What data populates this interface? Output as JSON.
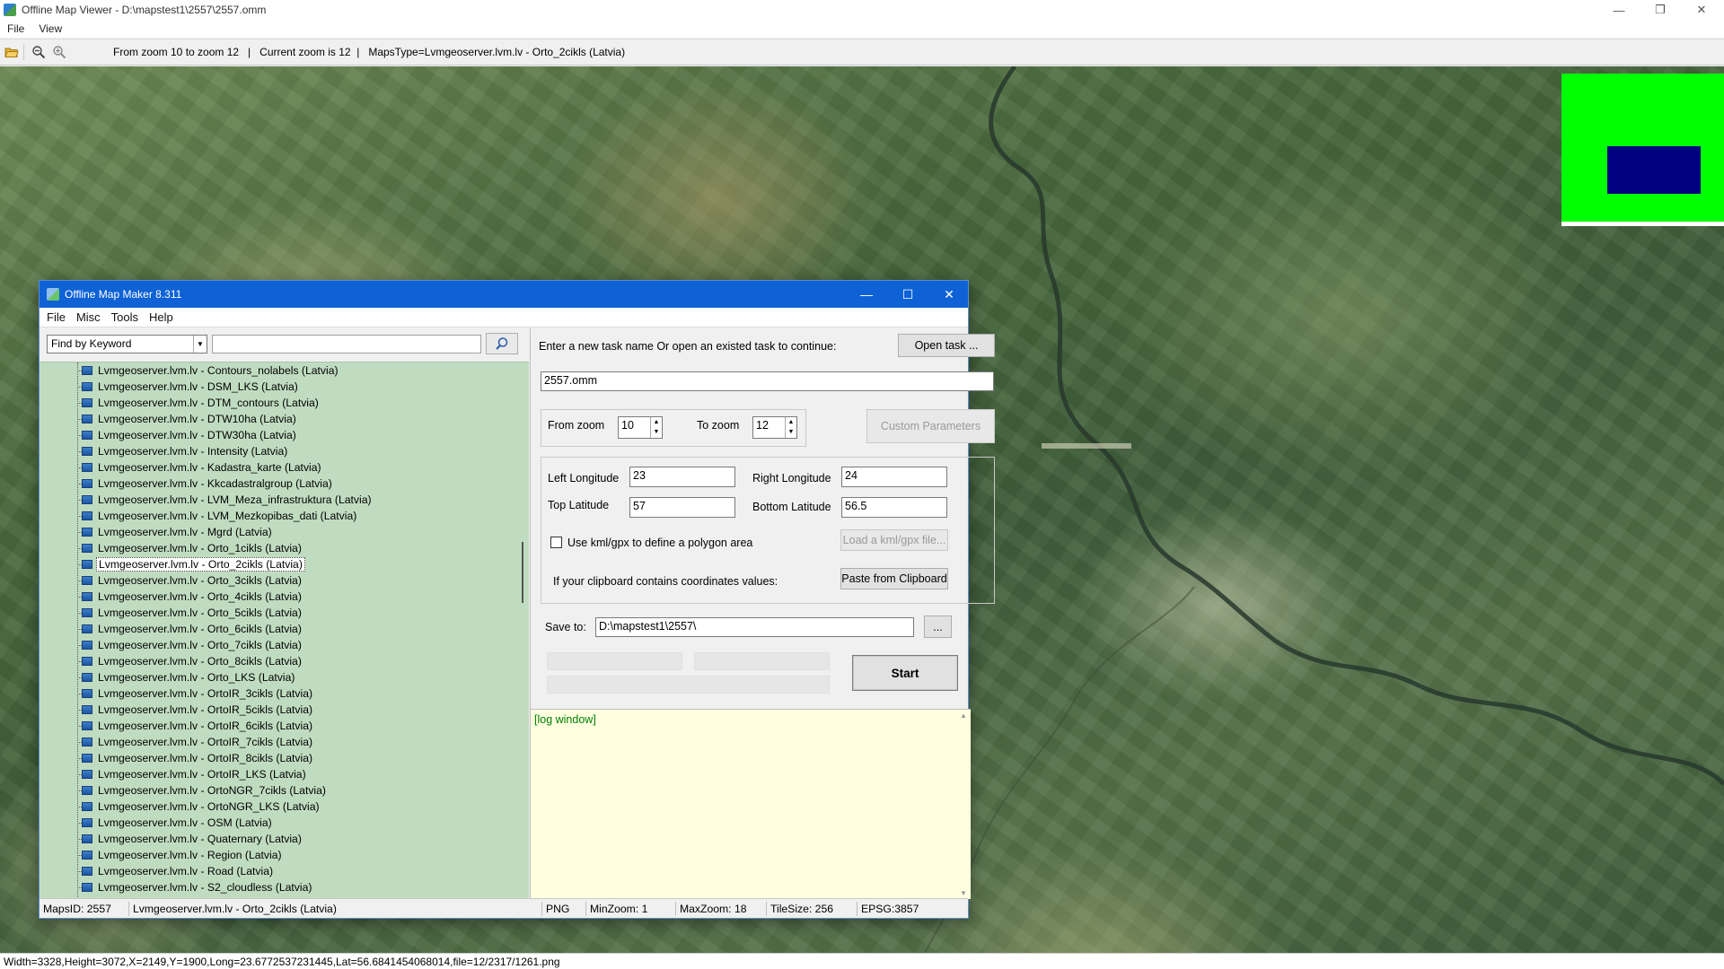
{
  "viewer": {
    "title": "Offline Map Viewer - D:\\mapstest1\\2557\\2557.omm",
    "window_controls": {
      "minimize": "—",
      "maximize": "❐",
      "close": "✕"
    },
    "menu": [
      "File",
      "View"
    ],
    "toolbar_info": "From zoom 10 to zoom 12   |   Current zoom is 12  |   MapsType=Lvmgeoserver.lvm.lv - Orto_2cikls (Latvia)",
    "status": "Width=3328,Height=3072,X=2149,Y=1900,Long=23.6772537231445,Lat=56.6841454068014,file=12/2317/1261.png",
    "minimap_colors": {
      "background": "#00ff00",
      "viewport": "#000080"
    }
  },
  "dialog": {
    "title": "Offline Map Maker 8.311",
    "window_controls": {
      "minimize": "—",
      "maximize": "☐",
      "close": "✕"
    },
    "menu": [
      "File",
      "Misc",
      "Tools",
      "Help"
    ],
    "search": {
      "mode": "Find by Keyword",
      "value": ""
    },
    "tree_items": [
      "Lvmgeoserver.lvm.lv - Contours_nolabels (Latvia)",
      "Lvmgeoserver.lvm.lv - DSM_LKS (Latvia)",
      "Lvmgeoserver.lvm.lv - DTM_contours (Latvia)",
      "Lvmgeoserver.lvm.lv - DTW10ha (Latvia)",
      "Lvmgeoserver.lvm.lv - DTW30ha (Latvia)",
      "Lvmgeoserver.lvm.lv - Intensity (Latvia)",
      "Lvmgeoserver.lvm.lv - Kadastra_karte (Latvia)",
      "Lvmgeoserver.lvm.lv - Kkcadastralgroup (Latvia)",
      "Lvmgeoserver.lvm.lv - LVM_Meza_infrastruktura (Latvia)",
      "Lvmgeoserver.lvm.lv - LVM_Mezkopibas_dati (Latvia)",
      "Lvmgeoserver.lvm.lv - Mgrd (Latvia)",
      "Lvmgeoserver.lvm.lv - Orto_1cikls (Latvia)",
      "Lvmgeoserver.lvm.lv - Orto_2cikls (Latvia)",
      "Lvmgeoserver.lvm.lv - Orto_3cikls (Latvia)",
      "Lvmgeoserver.lvm.lv - Orto_4cikls (Latvia)",
      "Lvmgeoserver.lvm.lv - Orto_5cikls (Latvia)",
      "Lvmgeoserver.lvm.lv - Orto_6cikls (Latvia)",
      "Lvmgeoserver.lvm.lv - Orto_7cikls (Latvia)",
      "Lvmgeoserver.lvm.lv - Orto_8cikls (Latvia)",
      "Lvmgeoserver.lvm.lv - Orto_LKS (Latvia)",
      "Lvmgeoserver.lvm.lv - OrtoIR_3cikls (Latvia)",
      "Lvmgeoserver.lvm.lv - OrtoIR_5cikls (Latvia)",
      "Lvmgeoserver.lvm.lv - OrtoIR_6cikls (Latvia)",
      "Lvmgeoserver.lvm.lv - OrtoIR_7cikls (Latvia)",
      "Lvmgeoserver.lvm.lv - OrtoIR_8cikls (Latvia)",
      "Lvmgeoserver.lvm.lv - OrtoIR_LKS (Latvia)",
      "Lvmgeoserver.lvm.lv - OrtoNGR_7cikls (Latvia)",
      "Lvmgeoserver.lvm.lv - OrtoNGR_LKS (Latvia)",
      "Lvmgeoserver.lvm.lv - OSM (Latvia)",
      "Lvmgeoserver.lvm.lv - Quaternary (Latvia)",
      "Lvmgeoserver.lvm.lv - Region (Latvia)",
      "Lvmgeoserver.lvm.lv - Road (Latvia)",
      "Lvmgeoserver.lvm.lv - S2_cloudless (Latvia)"
    ],
    "selected_index": 12,
    "task_prompt": "Enter a new task name Or open an existed task to continue:",
    "open_task_label": "Open task ...",
    "task_name": "2557.omm",
    "from_zoom_label": "From zoom",
    "from_zoom": "10",
    "to_zoom_label": "To zoom",
    "to_zoom": "12",
    "custom_params_label": "Custom Parameters",
    "left_lon_label": "Left Longitude",
    "left_lon": "23",
    "right_lon_label": "Right Longitude",
    "right_lon": "24",
    "top_lat_label": "Top Latitude",
    "top_lat": "57",
    "bottom_lat_label": "Bottom Latitude",
    "bottom_lat": "56.5",
    "kml_label": "Use kml/gpx to define a polygon area",
    "kml_checked": false,
    "load_kml_label": "Load a kml/gpx file...",
    "clipboard_label": "If your clipboard contains coordinates values:",
    "paste_label": "Paste from Clipboard",
    "save_to_label": "Save to:",
    "save_to": "D:\\mapstest1\\2557\\",
    "browse_label": "...",
    "start_label": "Start",
    "log_text": "[log window]",
    "status": {
      "maps_id": "MapsID: 2557",
      "map_name": "Lvmgeoserver.lvm.lv - Orto_2cikls (Latvia)",
      "format": "PNG",
      "min_zoom": "MinZoom: 1",
      "max_zoom": "MaxZoom: 18",
      "tile_size": "TileSize: 256",
      "epsg": "EPSG:3857"
    }
  }
}
